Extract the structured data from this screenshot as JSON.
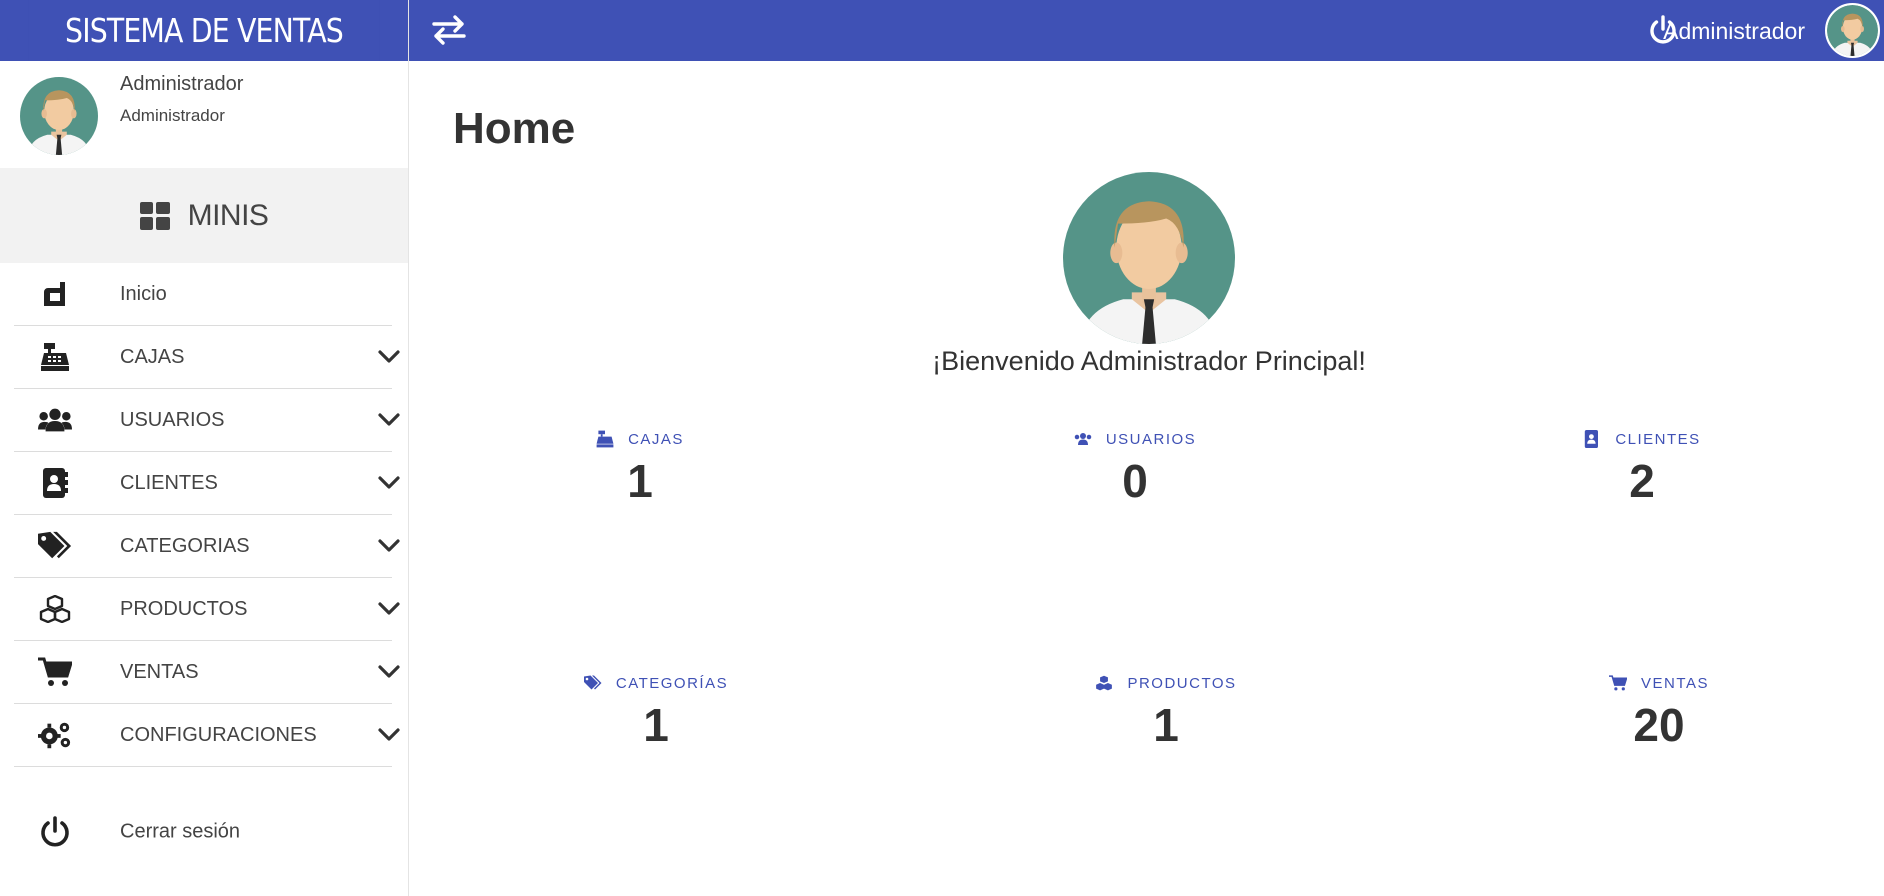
{
  "app": {
    "brand": "SISTEMA DE VENTAS"
  },
  "sidebar": {
    "user": {
      "name": "Administrador",
      "role": "Administrador"
    },
    "section": {
      "label": "MINIS"
    },
    "items": [
      {
        "label": "Inicio",
        "icon": "home-icon",
        "has_submenu": false
      },
      {
        "label": "CAJAS",
        "icon": "cash-register-icon",
        "has_submenu": true
      },
      {
        "label": "USUARIOS",
        "icon": "users-icon",
        "has_submenu": true
      },
      {
        "label": "CLIENTES",
        "icon": "address-book-icon",
        "has_submenu": true
      },
      {
        "label": "CATEGORIAS",
        "icon": "tags-icon",
        "has_submenu": true
      },
      {
        "label": "PRODUCTOS",
        "icon": "cubes-icon",
        "has_submenu": true
      },
      {
        "label": "VENTAS",
        "icon": "shopping-cart-icon",
        "has_submenu": true
      },
      {
        "label": "CONFIGURACIONES",
        "icon": "cogs-icon",
        "has_submenu": true
      }
    ],
    "logout": {
      "label": "Cerrar sesión",
      "icon": "power-icon"
    }
  },
  "topbar": {
    "toggle_icon": "swap-icon",
    "power_icon": "power-icon",
    "user_name": "Administrador"
  },
  "main": {
    "title": "Home",
    "welcome": "¡Bienvenido Administrador Principal!",
    "stats": [
      {
        "label": "CAJAS",
        "value": "1",
        "icon": "cash-register-icon"
      },
      {
        "label": "USUARIOS",
        "value": "0",
        "icon": "users-icon"
      },
      {
        "label": "CLIENTES",
        "value": "2",
        "icon": "address-book-icon"
      },
      {
        "label": "CATEGORÍAS",
        "value": "1",
        "icon": "tags-icon"
      },
      {
        "label": "PRODUCTOS",
        "value": "1",
        "icon": "cubes-icon"
      },
      {
        "label": "VENTAS",
        "value": "20",
        "icon": "shopping-cart-icon"
      }
    ]
  },
  "colors": {
    "primary": "#3f51b5",
    "avatar_bg": "#559488"
  }
}
